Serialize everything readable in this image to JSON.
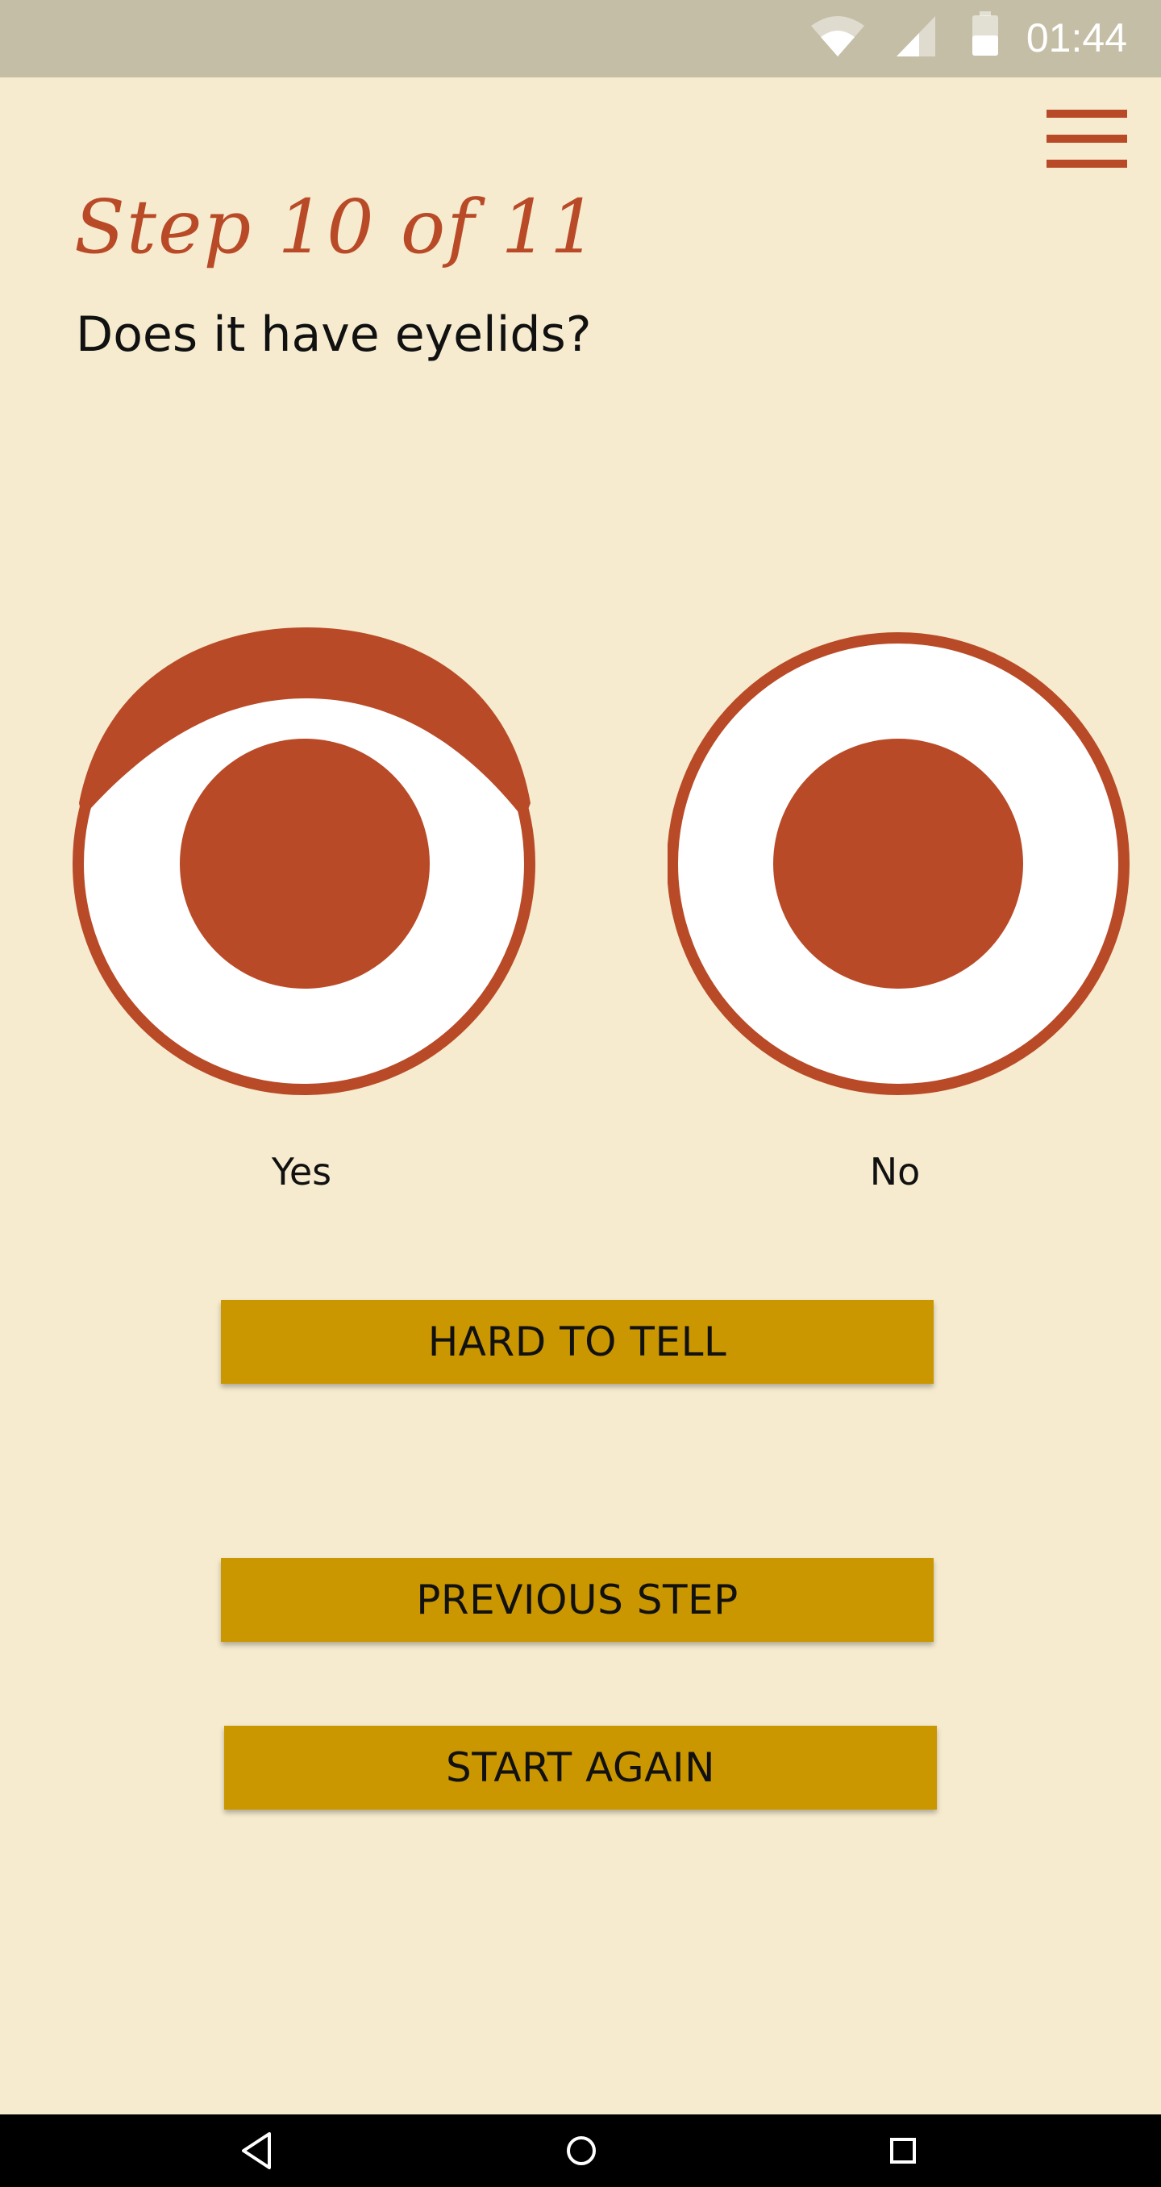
{
  "status_bar": {
    "time": "01:44",
    "icons": [
      "wifi-icon",
      "signal-icon",
      "battery-icon"
    ]
  },
  "header": {
    "menu_icon": "hamburger-menu-icon"
  },
  "main": {
    "step_title": "Step 10 of 11",
    "question": "Does it have eyelids?",
    "options": [
      {
        "label": "Yes",
        "icon": "eye-with-eyelid-icon"
      },
      {
        "label": "No",
        "icon": "eye-without-eyelid-icon"
      }
    ],
    "hard_to_tell_label": "HARD TO TELL",
    "previous_step_label": "PREVIOUS STEP",
    "start_again_label": "START AGAIN"
  },
  "nav_bar": {
    "icons": [
      "back-icon",
      "home-icon",
      "recents-icon"
    ]
  },
  "colors": {
    "background": "#F6EBCF",
    "accent": "#B94A27",
    "button": "#CB9700",
    "status_bar": "#C5BEA6"
  }
}
